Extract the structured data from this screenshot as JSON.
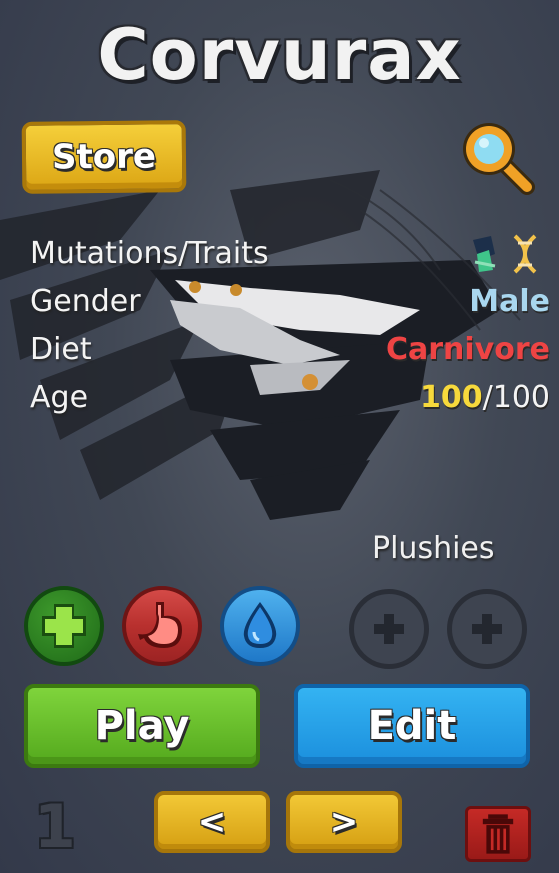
{
  "header": {
    "title": "Corvurax"
  },
  "toolbar": {
    "store_label": "Store"
  },
  "stats": {
    "mutations_label": "Mutations/Traits",
    "gender_label": "Gender",
    "gender_value": "Male",
    "diet_label": "Diet",
    "diet_value": "Carnivore",
    "age_label": "Age",
    "age_current": "100",
    "age_separator": "/",
    "age_max": "100"
  },
  "status_icons": [
    "health-plus-icon",
    "hunger-stomach-icon",
    "thirst-drop-icon"
  ],
  "plushies": {
    "label": "Plushies",
    "slots": [
      "empty",
      "empty"
    ]
  },
  "actions": {
    "play_label": "Play",
    "edit_label": "Edit"
  },
  "pager": {
    "slot_number": "1",
    "prev_label": "<",
    "next_label": ">"
  },
  "colors": {
    "gender": "#a9d7ef",
    "diet": "#ee4444",
    "age_current": "#f7d93c",
    "store_button": "#e8b823",
    "play_button": "#6cc22f",
    "edit_button": "#27a2ea",
    "delete_button": "#b3231f"
  }
}
